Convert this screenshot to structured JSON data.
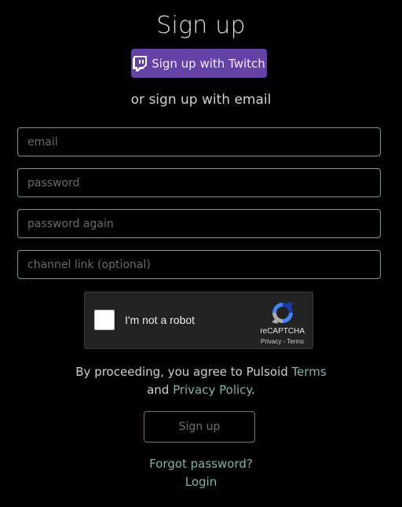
{
  "page": {
    "title": "Sign up"
  },
  "twitch_button": {
    "label": "Sign up with Twitch",
    "icon": "twitch-icon",
    "color": "#6441a5"
  },
  "divider_text": "or sign up with email",
  "fields": {
    "email": {
      "placeholder": "email",
      "value": ""
    },
    "password": {
      "placeholder": "password",
      "value": ""
    },
    "password_again": {
      "placeholder": "password again",
      "value": ""
    },
    "channel_link": {
      "placeholder": "channel link (optional)",
      "value": ""
    }
  },
  "recaptcha": {
    "label": "I'm not a robot",
    "brand": "reCAPTCHA",
    "privacy": "Privacy",
    "separator": " - ",
    "terms": "Terms",
    "checked": false
  },
  "agreement": {
    "prefix": "By proceeding, you agree to Pulsoid ",
    "terms_link": "Terms",
    "and_text": "and ",
    "privacy_link": "Privacy Policy",
    "suffix": "."
  },
  "signup_button": {
    "label": "Sign up"
  },
  "links": {
    "forgot_password": "Forgot password?",
    "login": "Login"
  },
  "colors": {
    "background": "#000000",
    "accent": "#7fb3a7",
    "field_border": "#6f9a92",
    "twitch": "#6441a5"
  }
}
